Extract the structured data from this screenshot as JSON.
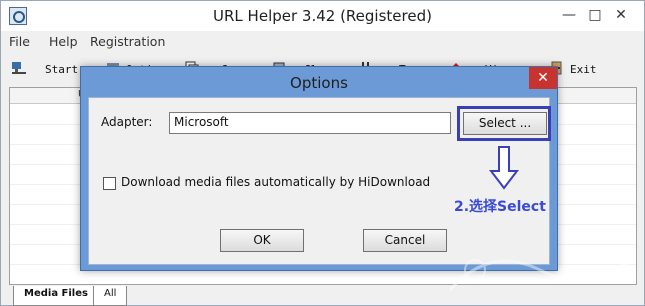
{
  "window": {
    "title": "URL Helper 3.42 (Registered)",
    "controls": {
      "minimize": "—",
      "maximize": "□",
      "close": "✕"
    }
  },
  "menu": {
    "items": [
      "File",
      "Help",
      "Registration"
    ]
  },
  "toolbar": {
    "start": "Start",
    "options": "Optio",
    "c2": "C",
    "c3": "Cl",
    "c4": "T",
    "c5": "Vi",
    "exit": "Exit"
  },
  "list": {
    "header_first": "U"
  },
  "bottom_tabs": [
    "Media Files",
    "All"
  ],
  "dialog": {
    "title": "Options",
    "close": "✕",
    "adapter_label": "Adapter:",
    "adapter_value": "Microsoft",
    "select_button": "Select ...",
    "checkbox_label": "Download media files automatically by HiDownload",
    "checkbox_checked": false,
    "annotation": "2.选择Select",
    "ok_button": "OK",
    "cancel_button": "Cancel",
    "highlight_color": "#3a3fb8",
    "annotation_color": "#3a4bd1"
  },
  "icons": [
    "app-icon",
    "start-icon",
    "options-icon",
    "copy-icon",
    "clear-icon",
    "tools-icon",
    "view-icon",
    "exit-icon",
    "down-arrow-icon"
  ]
}
